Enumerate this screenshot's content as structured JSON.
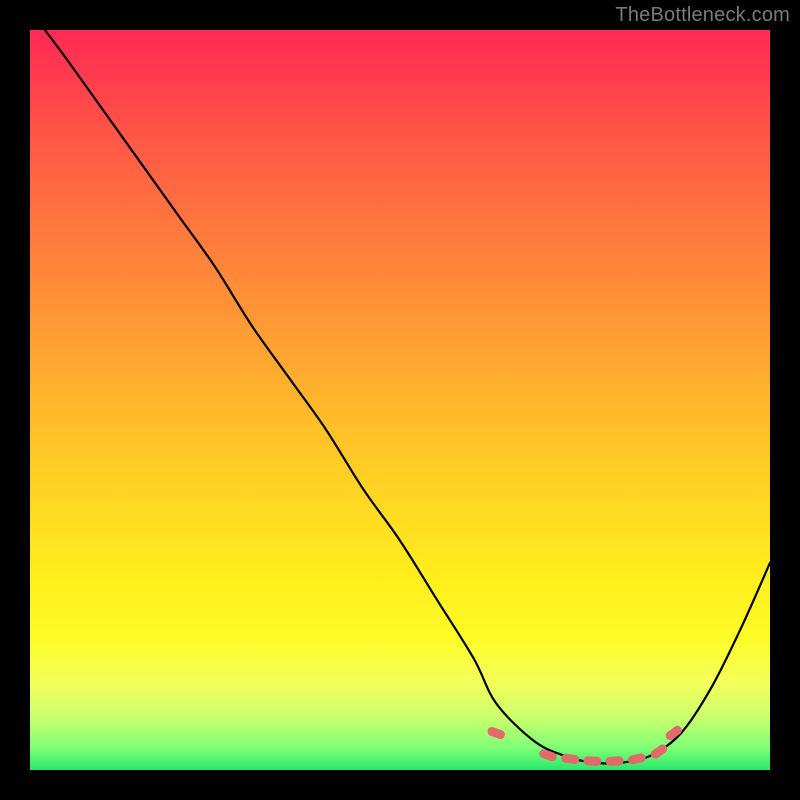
{
  "credit": "TheBottleneck.com",
  "colors": {
    "background": "#000000",
    "curve_stroke": "#000000",
    "marker_fill": "#e26a6a",
    "gradient_stops": [
      "#ff2a55",
      "#ffee1d",
      "#29e86a"
    ]
  },
  "chart_data": {
    "type": "line",
    "title": "",
    "xlabel": "",
    "ylabel": "",
    "x_range": [
      0,
      100
    ],
    "y_range": [
      0,
      100
    ],
    "note": "axes are unlabeled; x and y expressed as 0–100 percent of plot area, y=0 at bottom",
    "series": [
      {
        "name": "bottleneck-curve",
        "x": [
          2,
          5,
          10,
          15,
          20,
          25,
          30,
          35,
          40,
          45,
          50,
          55,
          60,
          63,
          68,
          72,
          76,
          80,
          84,
          88,
          92,
          96,
          100
        ],
        "y": [
          100,
          96,
          89,
          82,
          75,
          68,
          60,
          53,
          46,
          38,
          31,
          23,
          15,
          9,
          4,
          2,
          1,
          1,
          2,
          5,
          11,
          19,
          28
        ]
      }
    ],
    "markers": {
      "name": "optimal-range",
      "shape": "dash",
      "x": [
        63,
        70,
        73,
        76,
        79,
        82,
        85,
        87
      ],
      "y": [
        5,
        2,
        1.5,
        1.2,
        1.2,
        1.5,
        2.5,
        5
      ]
    }
  }
}
